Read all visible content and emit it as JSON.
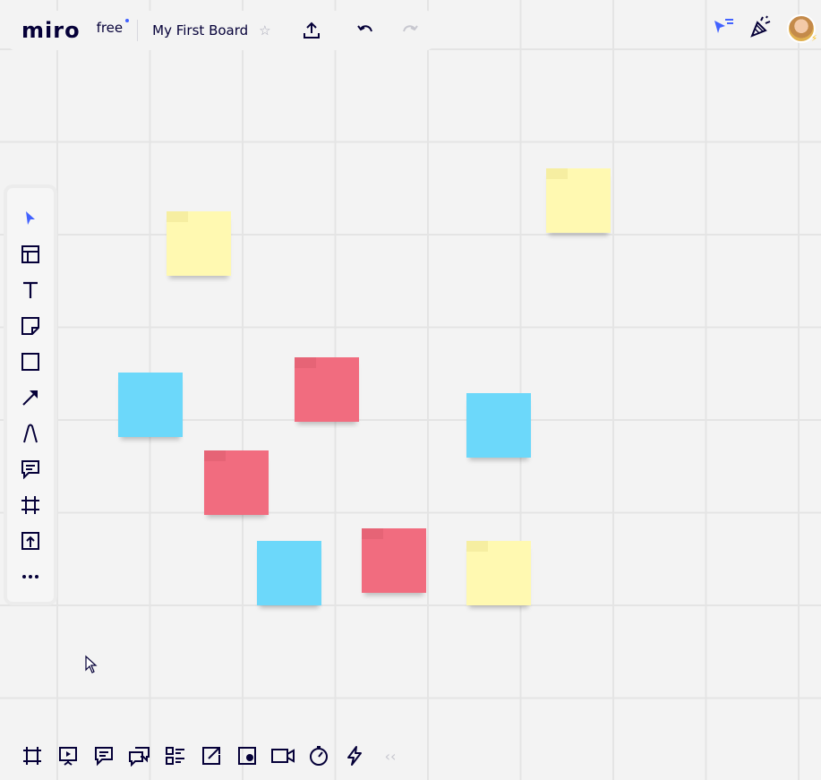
{
  "app": {
    "logo": "miro",
    "plan": "free",
    "board_title": "My First Board"
  },
  "topbar": {
    "star_icon": "☆",
    "share_icon": "upload-icon",
    "undo_icon": "undo-icon",
    "redo_icon": "redo-icon"
  },
  "topright": {
    "cursor_presence_icon": "cursor-list-icon",
    "celebrate_icon": "party-popper-icon",
    "avatar_badge": "⚡"
  },
  "left_toolbar": {
    "tools": [
      "select",
      "templates",
      "text",
      "sticky-note",
      "shape",
      "arrow",
      "pen",
      "comment",
      "frame",
      "upload",
      "more"
    ]
  },
  "stickies": [
    {
      "color": "yellow"
    },
    {
      "color": "yellow"
    },
    {
      "color": "blue"
    },
    {
      "color": "red"
    },
    {
      "color": "blue"
    },
    {
      "color": "red"
    },
    {
      "color": "blue"
    },
    {
      "color": "red"
    },
    {
      "color": "yellow"
    }
  ],
  "bottom_toolbar": {
    "tools": [
      "frames",
      "presentation",
      "comments",
      "chat",
      "card-list",
      "share-screen",
      "screen-record",
      "video-call",
      "timer",
      "voting"
    ],
    "collapse_label": "‹‹"
  },
  "colors": {
    "accent": "#4262ff",
    "text": "#050038",
    "sticky_yellow": "#fff9b1",
    "sticky_blue": "#6cd8fa",
    "sticky_red": "#f16c7f",
    "canvas": "#f3f3f3"
  }
}
